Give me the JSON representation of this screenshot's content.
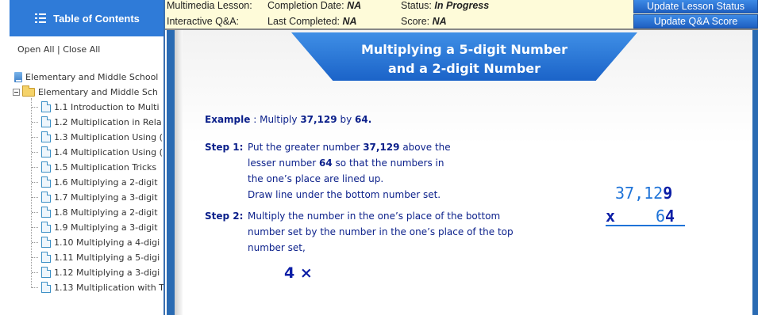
{
  "sidebar": {
    "header": "Table of Contents",
    "open_all": "Open All",
    "separator": "|",
    "close_all": "Close All",
    "tree": {
      "root": "Elementary and Middle School",
      "folder": "Elementary and Middle Sch",
      "items": [
        "1.1 Introduction to Multi",
        "1.2 Multiplication in Rela",
        "1.3 Multiplication Using (",
        "1.4 Multiplication Using (",
        "1.5 Multiplication Tricks",
        "1.6 Multiplying a 2-digit",
        "1.7 Multiplying a 3-digit",
        "1.8 Multiplying a 2-digit",
        "1.9 Multiplying a 3-digit",
        "1.10 Multiplying a 4-digi",
        "1.11 Multiplying a 5-digi",
        "1.12 Multiplying a 3-digi",
        "1.13 Multiplication with T"
      ]
    }
  },
  "infobar": {
    "row1": {
      "label": "Multimedia Lesson:",
      "completion_label": "Completion Date:",
      "completion_value": "NA",
      "status_label": "Status:",
      "status_value": "In Progress",
      "button": "Update Lesson Status"
    },
    "row2": {
      "label": "Interactive Q&A:",
      "completed_label": "Last Completed:",
      "completed_value": "NA",
      "score_label": "Score:",
      "score_value": "NA",
      "button": "Update Q&A Score"
    }
  },
  "lesson": {
    "title_line1": "Multiplying a 5-digit Number",
    "title_line2": "and a 2-digit Number",
    "example_label": "Example",
    "example_colon": ":",
    "example_text_a": "Multiply",
    "example_num1": "37,129",
    "example_text_b": "by",
    "example_num2": "64.",
    "step1_label": "Step 1:",
    "step1_a": "Put the greater number",
    "step1_num": "37,129",
    "step1_b": "above the",
    "step1_line2_a": "lesser number",
    "step1_line2_num": "64",
    "step1_line2_b": "so that the numbers in",
    "step1_line3": "the one’s place are lined up.",
    "step1_line4": "Draw line under the bottom number set.",
    "step2_label": "Step 2:",
    "step2_line1": "Multiply the number in the one’s place of the bottom",
    "step2_line2": "number set by the number in the one’s place of the top",
    "step2_line3": "number set,",
    "step2_expr": "4 ×",
    "calc_top_a": "37,12",
    "calc_top_b": "9",
    "calc_times": "x",
    "calc_bottom_a": "6",
    "calc_bottom_b": "4"
  },
  "colors": {
    "accent_blue": "#2f7bd8",
    "lesson_text": "#0a1f8a",
    "calc_blue": "#1e73d8",
    "infobar_bg": "#fefbd9"
  }
}
